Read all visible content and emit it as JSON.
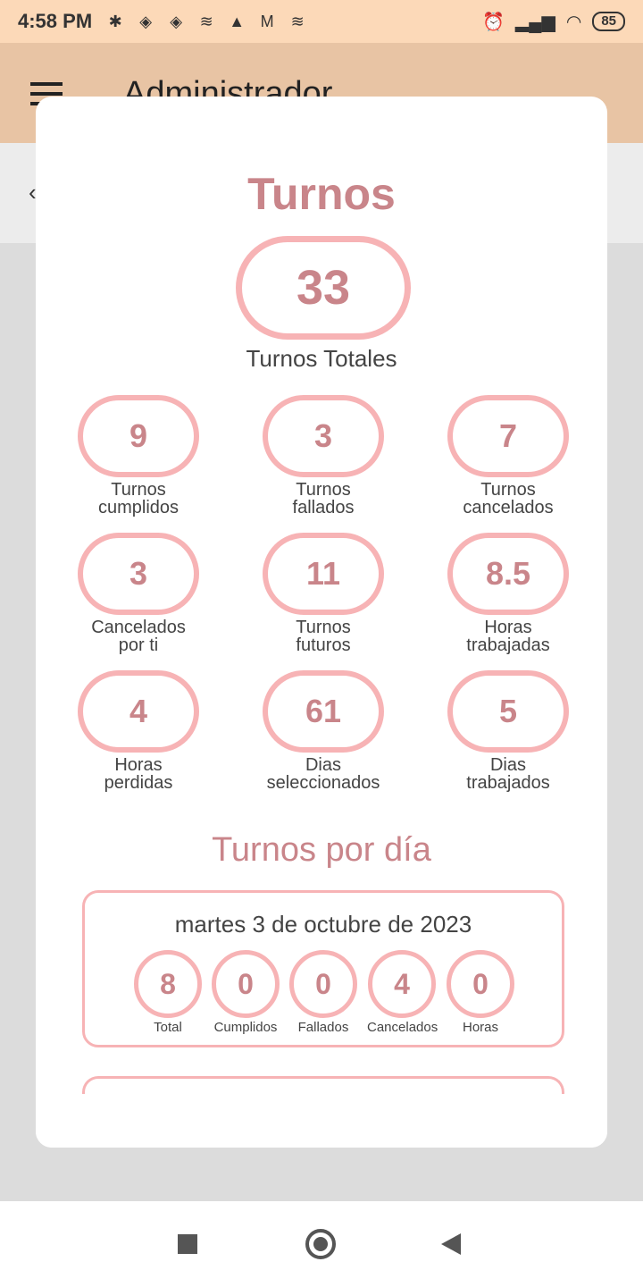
{
  "status_bar": {
    "time": "4:58 PM",
    "battery": "85"
  },
  "app_bar": {
    "title": "Administrador"
  },
  "dialog": {
    "title": "Turnos",
    "total_value": "33",
    "total_label": "Turnos Totales",
    "stats": [
      {
        "value": "9",
        "label": "Turnos\ncumplidos"
      },
      {
        "value": "3",
        "label": "Turnos\nfallados"
      },
      {
        "value": "7",
        "label": "Turnos\ncancelados"
      },
      {
        "value": "3",
        "label": "Cancelados\npor ti"
      },
      {
        "value": "11",
        "label": "Turnos\nfuturos"
      },
      {
        "value": "8.5",
        "label": "Horas\ntrabajadas"
      },
      {
        "value": "4",
        "label": "Horas\nperdidas"
      },
      {
        "value": "61",
        "label": "Dias\nseleccionados"
      },
      {
        "value": "5",
        "label": "Dias\ntrabajados"
      }
    ],
    "per_day_title": "Turnos por día",
    "days": [
      {
        "date": "martes 3 de octubre de 2023",
        "items": [
          {
            "value": "8",
            "label": "Total"
          },
          {
            "value": "0",
            "label": "Cumplidos"
          },
          {
            "value": "0",
            "label": "Fallados"
          },
          {
            "value": "4",
            "label": "Cancelados"
          },
          {
            "value": "0",
            "label": "Horas"
          }
        ]
      }
    ]
  },
  "colors": {
    "accent": "#c9858a",
    "pill_border": "#f7b3b5",
    "status_bar": "#fcd9b8",
    "app_bar": "#e8c4a4"
  }
}
